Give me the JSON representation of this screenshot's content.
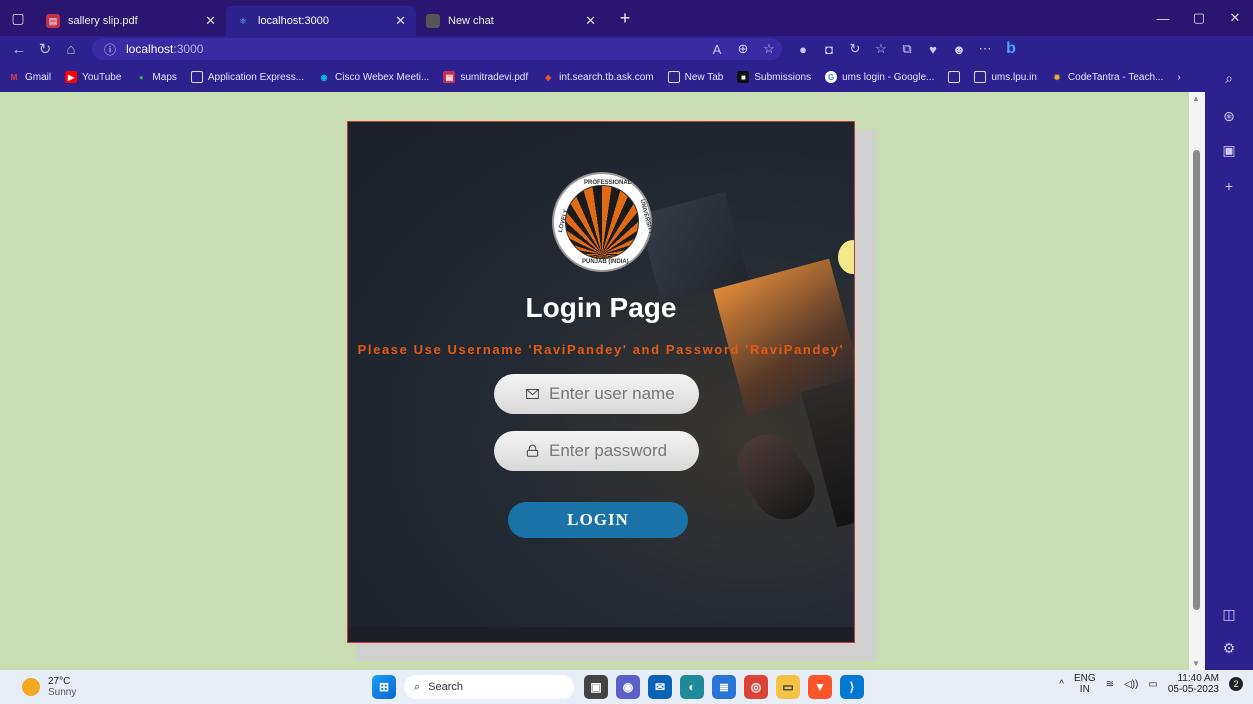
{
  "browser": {
    "tabs": [
      {
        "label": "sallery slip.pdf"
      },
      {
        "label": "localhost:3000"
      },
      {
        "label": "New chat"
      }
    ],
    "address_host": "localhost",
    "address_port": ":3000"
  },
  "bookmarks": [
    {
      "label": "Gmail"
    },
    {
      "label": "YouTube"
    },
    {
      "label": "Maps"
    },
    {
      "label": "Application Express..."
    },
    {
      "label": "Cisco Webex Meeti..."
    },
    {
      "label": "sumitradevi.pdf"
    },
    {
      "label": "int.search.tb.ask.com"
    },
    {
      "label": "New Tab"
    },
    {
      "label": "Submissions"
    },
    {
      "label": "ums login - Google..."
    },
    {
      "label": "ums.lpu.in"
    },
    {
      "label": "CodeTantra - Teach..."
    }
  ],
  "page": {
    "logo_top": "PROFESSIONAL",
    "logo_left": "LOVELY",
    "logo_right": "UNIVERSITY",
    "logo_bottom": "PUNJAB (INDIA)",
    "title": "Login Page",
    "hint": "Please Use Username 'RaviPandey' and Password 'RaviPandey'",
    "username_placeholder": "Enter user name",
    "password_placeholder": "Enter password",
    "login_label": "LOGIN"
  },
  "taskbar": {
    "weather_temp": "27°C",
    "weather_desc": "Sunny",
    "search_label": "Search",
    "lang_top": "ENG",
    "lang_bottom": "IN",
    "time": "11:40 AM",
    "date": "05-05-2023",
    "notif_count": "2"
  },
  "colors": {
    "page_bg": "#c9ddb3",
    "browser_frame": "#2d2190",
    "hint_text": "#e05a14",
    "login_button": "#1b73a8"
  }
}
